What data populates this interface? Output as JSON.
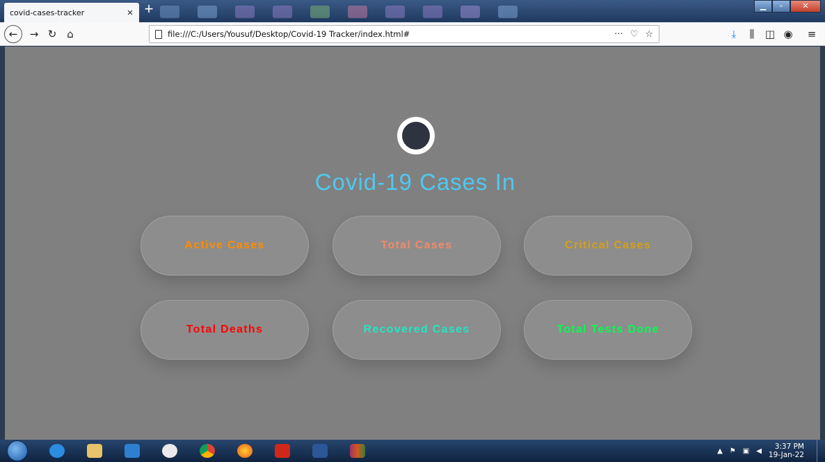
{
  "browser": {
    "tab_title": "covid-cases-tracker",
    "tab_close": "×",
    "new_tab": "+",
    "url": "file:///C:/Users/Yousuf/Desktop/Covid-19 Tracker/index.html#",
    "url_menu": "···"
  },
  "page": {
    "heading": "Covid-19 Cases In",
    "cards": [
      {
        "label": "Active Cases",
        "color": "#ff8c00"
      },
      {
        "label": "Total Cases",
        "color": "#f08a6a"
      },
      {
        "label": "Critical Cases",
        "color": "#d4a017"
      },
      {
        "label": "Total Deaths",
        "color": "#ff0000"
      },
      {
        "label": "Recovered Cases",
        "color": "#21e6c1"
      },
      {
        "label": "Total Tests Done",
        "color": "#00ff4c"
      }
    ]
  },
  "taskbar": {
    "apps": [
      "internet-explorer",
      "file-explorer",
      "media-player",
      "inkscape",
      "chrome",
      "firefox",
      "acrobat",
      "word",
      "winrar"
    ],
    "time": "3:37 PM",
    "date": "19-Jan-22"
  }
}
